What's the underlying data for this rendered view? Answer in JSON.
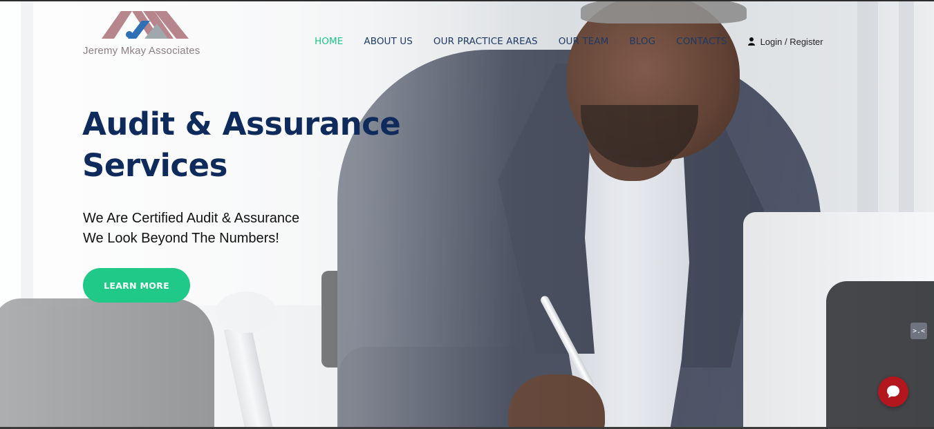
{
  "brand": {
    "name": "Jeremy Mkay Associates",
    "logo_icon": "house-roof-logo"
  },
  "nav": {
    "items": [
      {
        "label": "HOME",
        "active": true
      },
      {
        "label": "ABOUT US",
        "active": false
      },
      {
        "label": "OUR PRACTICE AREAS",
        "active": false
      },
      {
        "label": "OUR TEAM",
        "active": false
      },
      {
        "label": "BLOG",
        "active": false
      },
      {
        "label": "CONTACTS",
        "active": false
      }
    ],
    "login_label": "Login / Register",
    "login_icon": "user-icon"
  },
  "hero": {
    "title_line1": "Audit & Assurance",
    "title_line2": "Services",
    "subtitle_line1": "We Are Certified Audit & Assurance",
    "subtitle_line2": "We Look Beyond The Numbers!",
    "cta_label": "LEARN MORE"
  },
  "widgets": {
    "side_widget_glyph": ">.<",
    "chat_icon": "chat-bubble-icon"
  },
  "colors": {
    "accent": "#20c987",
    "active_nav": "#1ec48a",
    "nav_text": "#1e3a63",
    "title": "#0e2b5c",
    "chat_button": "#b3161c"
  }
}
